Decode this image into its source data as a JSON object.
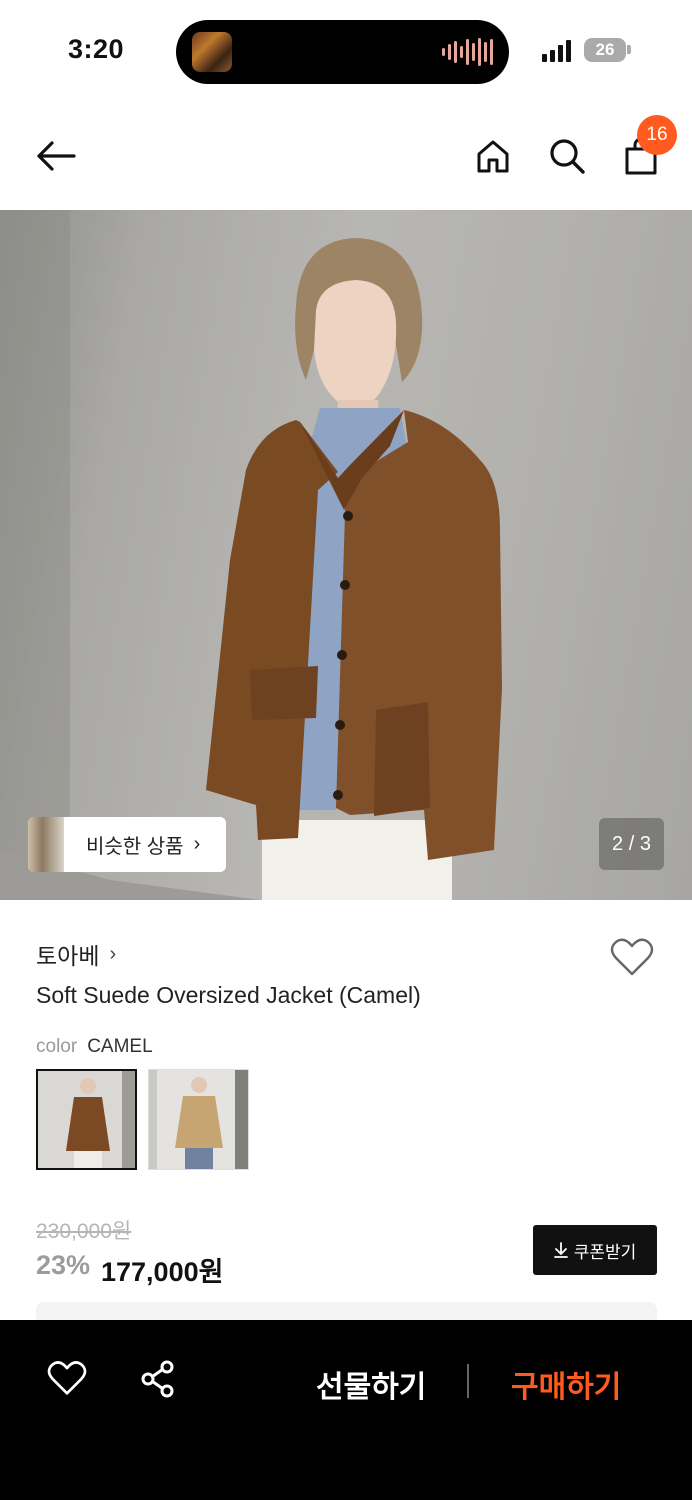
{
  "status_bar": {
    "time": "3:20",
    "battery": "26"
  },
  "header": {
    "cart_count": "16"
  },
  "hero": {
    "similar_label": "비슷한 상품",
    "page_indicator": "2 / 3"
  },
  "product": {
    "brand": "토아베",
    "title": "Soft Suede Oversized Jacket (Camel)",
    "color_key": "color",
    "color_value": "CAMEL",
    "original_price": "230,000원",
    "discount": "23%",
    "sale_price": "177,000원",
    "coupon_label": "쿠폰받기"
  },
  "bottom_bar": {
    "gift_label": "선물하기",
    "buy_label": "구매하기"
  },
  "colors": {
    "accent": "#ff5a1f",
    "bar_bg": "#000000"
  },
  "icons": [
    "back-arrow-icon",
    "home-icon",
    "search-icon",
    "shopping-bag-icon",
    "heart-icon",
    "share-icon",
    "download-icon",
    "chevron-right-icon"
  ]
}
